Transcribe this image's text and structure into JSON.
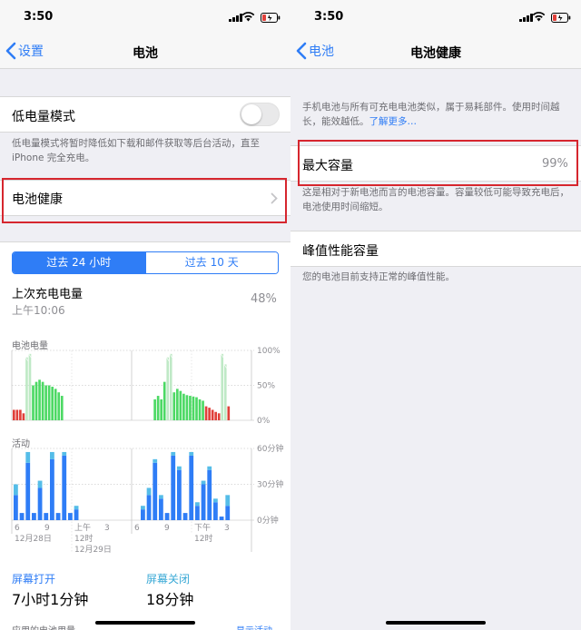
{
  "left": {
    "status": {
      "time": "3:50"
    },
    "nav": {
      "back_label": "设置",
      "title": "电池"
    },
    "low_power": {
      "label": "低电量模式",
      "description": "低电量模式将暂时降低如下载和邮件获取等后台活动，直至 iPhone 完全充电。",
      "enabled": false
    },
    "battery_health": {
      "label": "电池健康"
    },
    "segment": {
      "active": "过去 24 小时",
      "inactive": "过去 10 天"
    },
    "last_charge": {
      "label": "上次充电电量",
      "time": "上午10:06",
      "value": "48%"
    },
    "level_chart": {
      "label": "电池电量",
      "ticks": [
        "100%",
        "50%",
        "0%"
      ],
      "bar_levels": [
        0.15,
        0.15,
        0.15,
        0.1,
        0.9,
        0.95,
        0.5,
        0.55,
        0.58,
        0.55,
        0.5,
        0.5,
        0.48,
        0.45,
        0.4,
        0.35,
        0,
        0,
        0,
        0,
        0,
        0,
        0,
        0,
        0,
        0,
        0,
        0,
        0,
        0,
        0,
        0,
        0,
        0,
        0,
        0,
        0,
        0,
        0,
        0,
        0,
        0,
        0,
        0,
        0.3,
        0.35,
        0.3,
        0.55,
        0.9,
        0.95,
        0.4,
        0.45,
        0.42,
        0.38,
        0.36,
        0.35,
        0.34,
        0.33,
        0.3,
        0.28,
        0.2,
        0.18,
        0.15,
        0.12,
        0.1,
        0.95,
        0.8,
        0.2
      ],
      "charging_from": [
        4,
        5,
        48,
        49,
        65,
        66
      ]
    },
    "activity_chart": {
      "label": "活动",
      "ticks": [
        "60分钟",
        "30分钟",
        "0分钟"
      ],
      "screen_on": [
        0.35,
        0.1,
        0.8,
        0.1,
        0.45,
        0.1,
        0.85,
        0.1,
        0.9,
        0.1,
        0.15,
        0,
        0,
        0,
        0,
        0,
        0,
        0,
        0,
        0,
        0,
        0.15,
        0.35,
        0.8,
        0.3,
        0.1,
        0.9,
        0.7,
        0.1,
        0.9,
        0.2,
        0.5,
        0.7,
        0.25,
        0.05,
        0.2
      ],
      "screen_off": [
        0.15,
        0,
        0.15,
        0,
        0.1,
        0,
        0.1,
        0,
        0.05,
        0,
        0.05,
        0,
        0,
        0,
        0,
        0,
        0,
        0,
        0,
        0,
        0,
        0.05,
        0.1,
        0.05,
        0.05,
        0,
        0.05,
        0.05,
        0,
        0.05,
        0.05,
        0.05,
        0.05,
        0.05,
        0,
        0.15
      ]
    },
    "x_axis": {
      "row1": [
        "6",
        "9",
        "上午",
        "3",
        "6",
        "9",
        "下午",
        "3"
      ],
      "row2": [
        "12月28日",
        "12时",
        "12时"
      ],
      "row3": [
        "12月29日"
      ]
    },
    "stats": {
      "on_label": "屏幕打开",
      "on_value": "7小时1分钟",
      "off_label": "屏幕关闭",
      "off_value": "18分钟"
    },
    "bottom": {
      "left": "应用的电池用量",
      "right": "显示活动"
    }
  },
  "right": {
    "status": {
      "time": "3:50"
    },
    "nav": {
      "back_label": "电池",
      "title": "电池健康"
    },
    "intro": {
      "text": "手机电池与所有可充电电池类似，属于易耗部件。使用时间越长，能效越低。",
      "link": "了解更多…"
    },
    "max_capacity": {
      "label": "最大容量",
      "value": "99%",
      "description": "这是相对于新电池而言的电池容量。容量较低可能导致充电后，电池使用时间缩短。"
    },
    "peak": {
      "label": "峰值性能容量",
      "description": "您的电池目前支持正常的峰值性能。"
    }
  },
  "colors": {
    "accent": "#2f7df6",
    "highlight": "#d6262e",
    "green": "#4cd964",
    "red": "#e0403a",
    "teal": "#55bde8"
  }
}
